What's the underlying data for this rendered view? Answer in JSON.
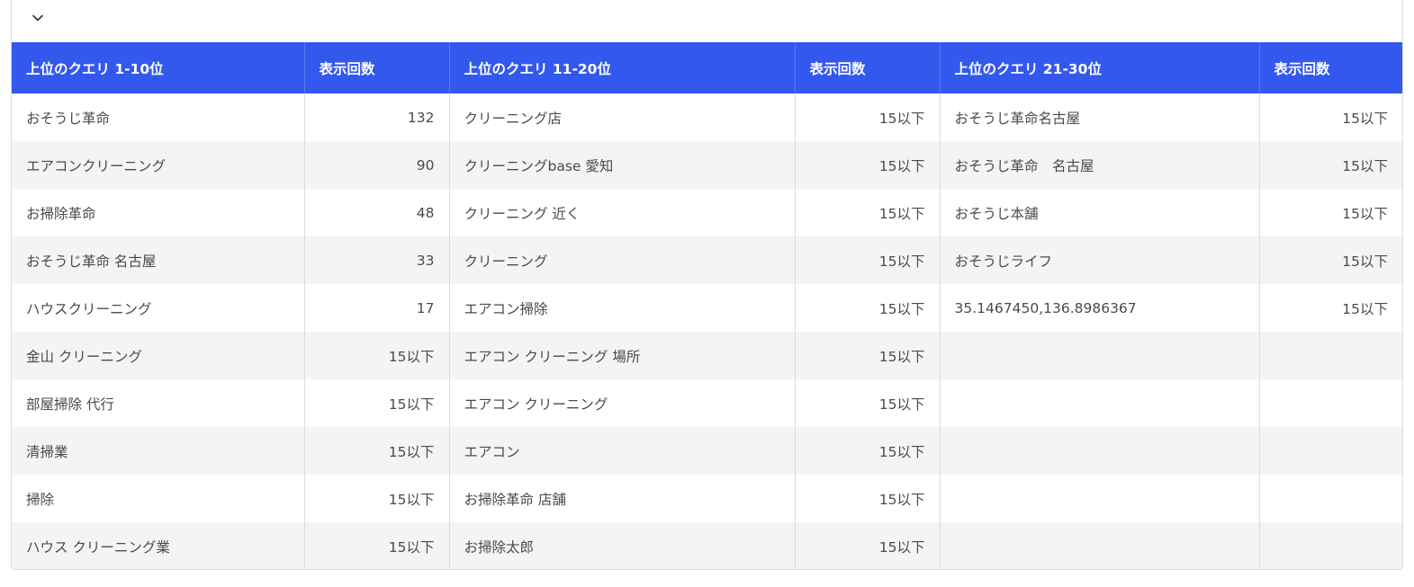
{
  "headers": [
    "上位のクエリ 1-10位",
    "表示回数",
    "上位のクエリ 11-20位",
    "表示回数",
    "上位のクエリ 21-30位",
    "表示回数"
  ],
  "rows": [
    [
      "おそうじ革命",
      "132",
      "クリーニング店",
      "15以下",
      "おそうじ革命名古屋",
      "15以下"
    ],
    [
      "エアコンクリーニング",
      "90",
      "クリーニングbase 愛知",
      "15以下",
      "おそうじ革命　名古屋",
      "15以下"
    ],
    [
      "お掃除革命",
      "48",
      "クリーニング 近く",
      "15以下",
      "おそうじ本舗",
      "15以下"
    ],
    [
      "おそうじ革命 名古屋",
      "33",
      "クリーニング",
      "15以下",
      "おそうじライフ",
      "15以下"
    ],
    [
      "ハウスクリーニング",
      "17",
      "エアコン掃除",
      "15以下",
      "35.1467450,136.8986367",
      "15以下"
    ],
    [
      "金山 クリーニング",
      "15以下",
      "エアコン クリーニング 場所",
      "15以下",
      "",
      ""
    ],
    [
      "部屋掃除 代行",
      "15以下",
      "エアコン クリーニング",
      "15以下",
      "",
      ""
    ],
    [
      "清掃業",
      "15以下",
      "エアコン",
      "15以下",
      "",
      ""
    ],
    [
      "掃除",
      "15以下",
      "お掃除革命 店舗",
      "15以下",
      "",
      ""
    ],
    [
      "ハウス クリーニング業",
      "15以下",
      "お掃除太郎",
      "15以下",
      "",
      ""
    ]
  ],
  "colors": {
    "header_bg": "#3358ee",
    "header_text": "#ffffff",
    "row_alt_bg": "#f4f4f4"
  },
  "icons": {
    "toggle": "chevron-down-icon"
  }
}
